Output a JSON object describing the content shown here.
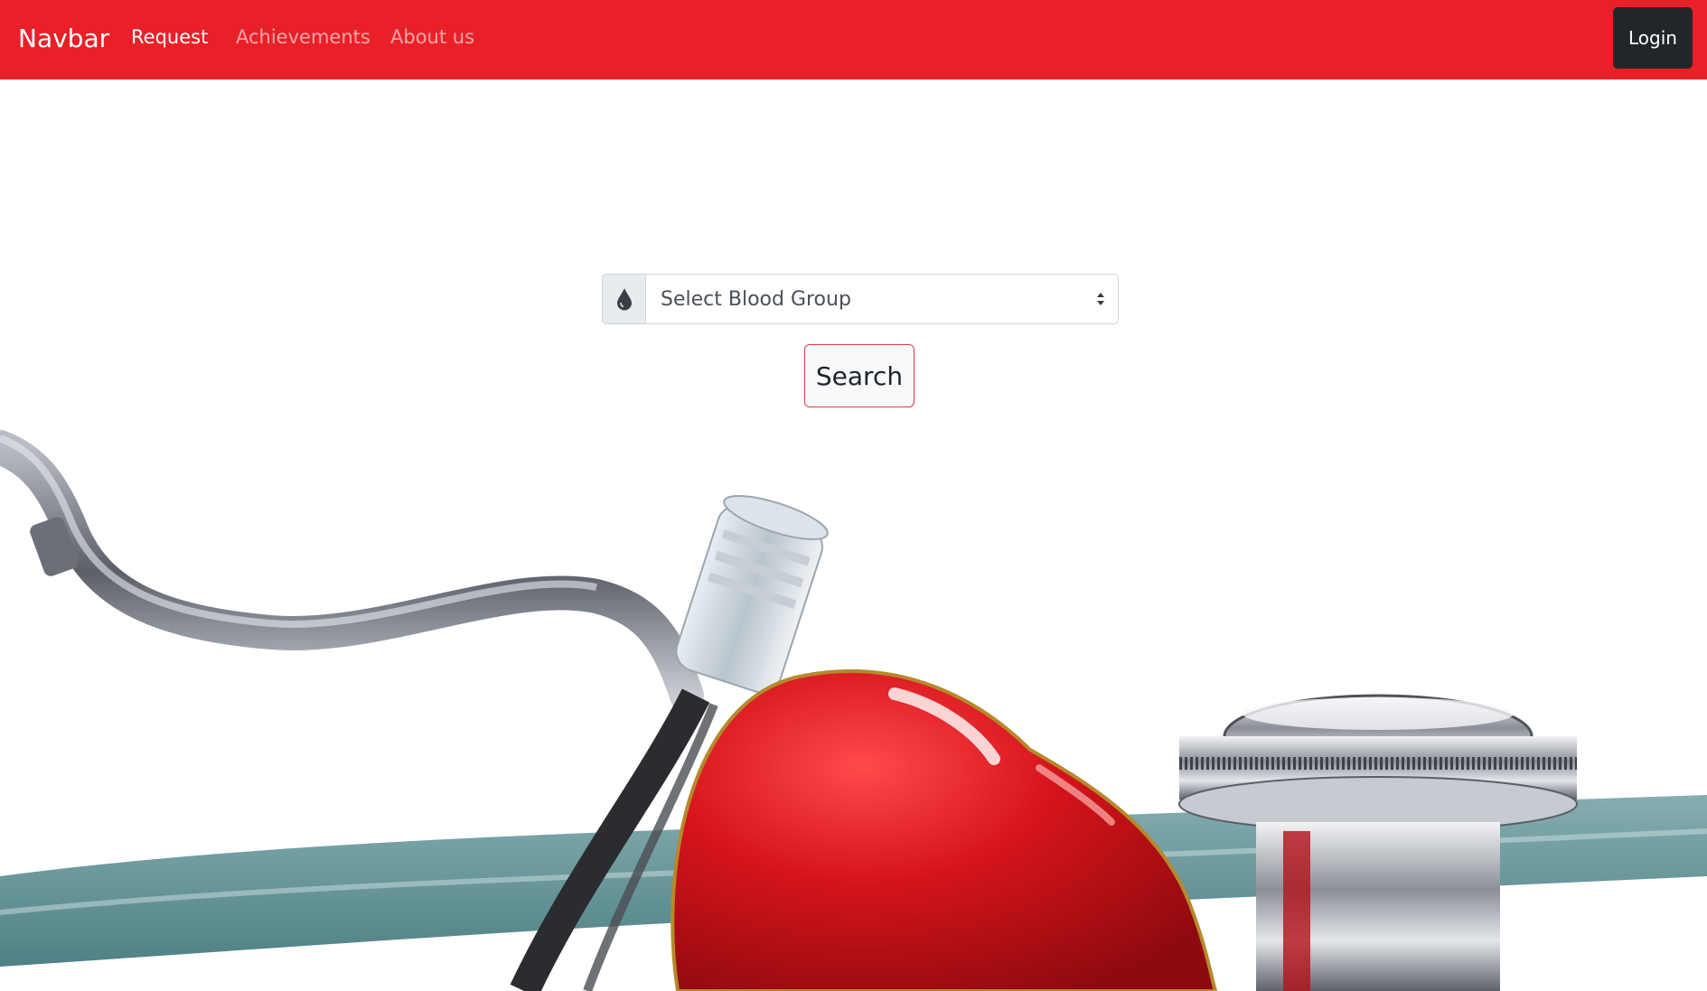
{
  "navbar": {
    "brand": "Navbar",
    "links": [
      {
        "label": "Request",
        "active": true
      },
      {
        "label": "Achievements",
        "active": false
      },
      {
        "label": "About us",
        "active": false
      }
    ],
    "login_label": "Login"
  },
  "search": {
    "icon": "blood-drop-icon",
    "select_placeholder": "Select Blood Group",
    "button_label": "Search"
  },
  "hero": {
    "image": "stethoscope-with-red-heart"
  },
  "colors": {
    "navbar_bg": "#ea2028",
    "login_bg": "#22262b",
    "heart_red": "#d5141b",
    "search_border": "#e03a44"
  }
}
